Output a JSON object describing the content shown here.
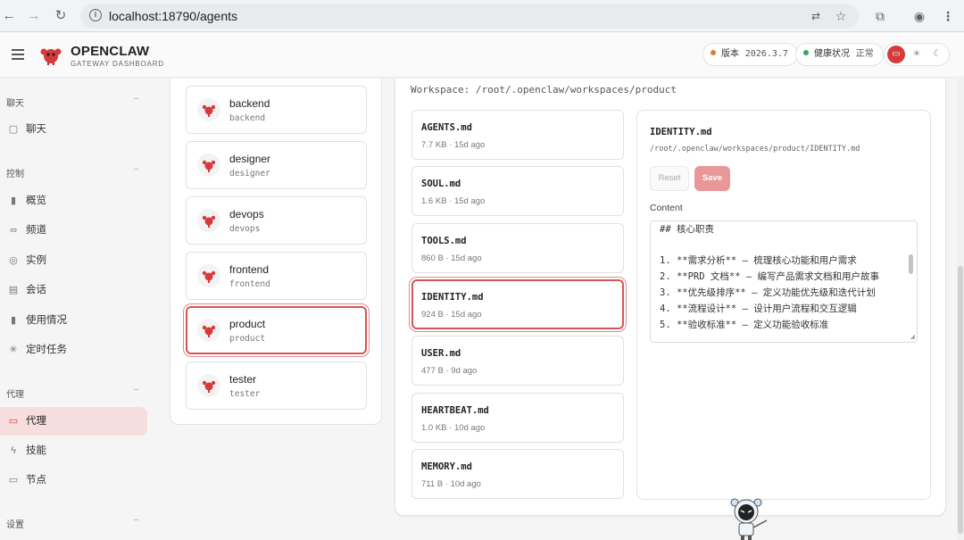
{
  "browser": {
    "url": "localhost:18790/agents"
  },
  "header": {
    "brand_title": "OPENCLAW",
    "brand_subtitle": "GATEWAY DASHBOARD",
    "version_label": "版本",
    "version_value": "2026.3.7",
    "health_label": "健康状况",
    "health_value": "正常"
  },
  "sidebar": {
    "sections": [
      {
        "title": "聊天",
        "items": [
          {
            "label": "聊天",
            "icon": "chat-icon"
          }
        ]
      },
      {
        "title": "控制",
        "items": [
          {
            "label": "概览",
            "icon": "bar-chart-icon"
          },
          {
            "label": "频道",
            "icon": "link-icon"
          },
          {
            "label": "实例",
            "icon": "broadcast-icon"
          },
          {
            "label": "会话",
            "icon": "document-icon"
          },
          {
            "label": "使用情况",
            "icon": "bar-chart-icon"
          },
          {
            "label": "定时任务",
            "icon": "sun-icon"
          }
        ]
      },
      {
        "title": "代理",
        "items": [
          {
            "label": "代理",
            "icon": "folder-icon",
            "active": true
          },
          {
            "label": "技能",
            "icon": "bolt-icon"
          },
          {
            "label": "节点",
            "icon": "monitor-icon"
          }
        ]
      },
      {
        "title": "设置",
        "items": []
      }
    ]
  },
  "agents": [
    {
      "name": "backend",
      "id": "backend"
    },
    {
      "name": "designer",
      "id": "designer"
    },
    {
      "name": "devops",
      "id": "devops"
    },
    {
      "name": "frontend",
      "id": "frontend"
    },
    {
      "name": "product",
      "id": "product",
      "selected": true
    },
    {
      "name": "tester",
      "id": "tester"
    }
  ],
  "workspace": {
    "label": "Workspace: /root/.openclaw/workspaces/product"
  },
  "files": [
    {
      "name": "AGENTS.md",
      "meta": "7.7 KB · 15d ago"
    },
    {
      "name": "SOUL.md",
      "meta": "1.6 KB · 15d ago"
    },
    {
      "name": "TOOLS.md",
      "meta": "860 B · 15d ago"
    },
    {
      "name": "IDENTITY.md",
      "meta": "924 B · 15d ago",
      "selected": true
    },
    {
      "name": "USER.md",
      "meta": "477 B · 9d ago"
    },
    {
      "name": "HEARTBEAT.md",
      "meta": "1.0 KB · 10d ago"
    },
    {
      "name": "MEMORY.md",
      "meta": "711 B · 10d ago"
    }
  ],
  "editor": {
    "title": "IDENTITY.md",
    "path": "/root/.openclaw/workspaces/product/IDENTITY.md",
    "reset_label": "Reset",
    "save_label": "Save",
    "content_label": "Content",
    "lines": [
      "## 核心职责",
      "",
      "1. **需求分析** — 梳理核心功能和用户需求",
      "2. **PRD 文档** — 编写产品需求文档和用户故事",
      "3. **优先级排序** — 定义功能优先级和迭代计划",
      "4. **流程设计** — 设计用户流程和交互逻辑",
      "5. **验收标准** — 定义功能验收标准"
    ]
  },
  "colors": {
    "accent": "#d63a3a",
    "selected_border": "#d65454",
    "active_nav_bg": "#f6dede",
    "save_button": "#e89898",
    "version_dot": "#e07b2a",
    "health_dot": "#2eaa5c"
  }
}
